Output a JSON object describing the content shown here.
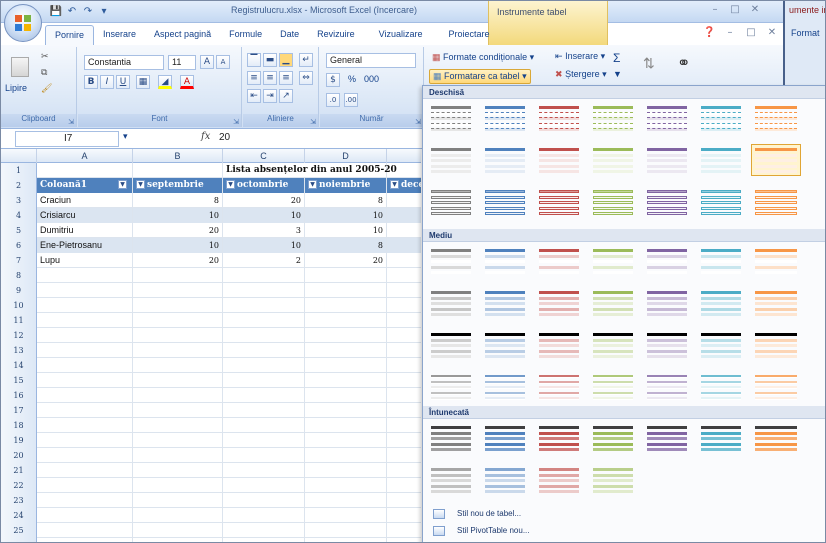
{
  "window": {
    "title": "Registrulucru.xlsx - Microsoft Excel (încercare)",
    "contextual_header": "Instrumente tabel",
    "second_app_title": "umente imag",
    "second_app_tab": "Format"
  },
  "tabs": [
    {
      "label": "Pornire",
      "active": true
    },
    {
      "label": "Inserare",
      "active": false
    },
    {
      "label": "Aspect pagină",
      "active": false
    },
    {
      "label": "Formule",
      "active": false
    },
    {
      "label": "Date",
      "active": false
    },
    {
      "label": "Revizuire",
      "active": false
    },
    {
      "label": "Vizualizare",
      "active": false
    },
    {
      "label": "Proiectare",
      "active": false
    }
  ],
  "ribbon": {
    "clipboard": {
      "label": "Clipboard",
      "paste": "Lipire"
    },
    "font": {
      "label": "Font",
      "name": "Constantia",
      "size": "11"
    },
    "alignment": {
      "label": "Aliniere"
    },
    "number": {
      "label": "Număr",
      "format": "General",
      "percent": "%",
      "thousands": "000"
    },
    "styles": {
      "conditional_formatting": "Formate condiționale",
      "format_as_table": "Formatare ca tabel",
      "insert": "Inserare",
      "delete": "Ștergere"
    }
  },
  "formula_bar": {
    "name_box": "I7",
    "fx": "fx",
    "value": "20"
  },
  "sheet": {
    "columns": [
      "A",
      "B",
      "C",
      "D"
    ],
    "title": "Lista absențelor din anul 2005-20",
    "header_row": [
      "Coloană1",
      "septembrie",
      "octombrie",
      "noiembrie",
      "decem"
    ],
    "rows": [
      {
        "n": "3",
        "name": "Craciun",
        "b": "8",
        "c": "20",
        "d": "8"
      },
      {
        "n": "4",
        "name": "Crisiarcu",
        "b": "10",
        "c": "10",
        "d": "10"
      },
      {
        "n": "5",
        "name": "Dumitriu",
        "b": "20",
        "c": "3",
        "d": "10"
      },
      {
        "n": "6",
        "name": "Ene-Pietrosanu",
        "b": "10",
        "c": "10",
        "d": "8"
      },
      {
        "n": "7",
        "name": "Lupu",
        "b": "20",
        "c": "2",
        "d": "20"
      }
    ],
    "row_numbers": [
      "1",
      "2",
      "3",
      "4",
      "5",
      "6",
      "7",
      "8",
      "9",
      "10",
      "11",
      "12",
      "13",
      "14",
      "15",
      "16",
      "17",
      "18",
      "19",
      "20",
      "21",
      "22",
      "23",
      "24",
      "25",
      "26"
    ]
  },
  "gallery": {
    "light": "Deschisă",
    "medium": "Mediu",
    "dark": "Întunecată",
    "new_table_style": "Stil nou de tabel...",
    "new_pivot_style": "Stil PivotTable nou...",
    "palette": [
      "#808080",
      "#4f81bd",
      "#c0504d",
      "#9bbb59",
      "#8064a2",
      "#4bacc6",
      "#f79646"
    ]
  }
}
